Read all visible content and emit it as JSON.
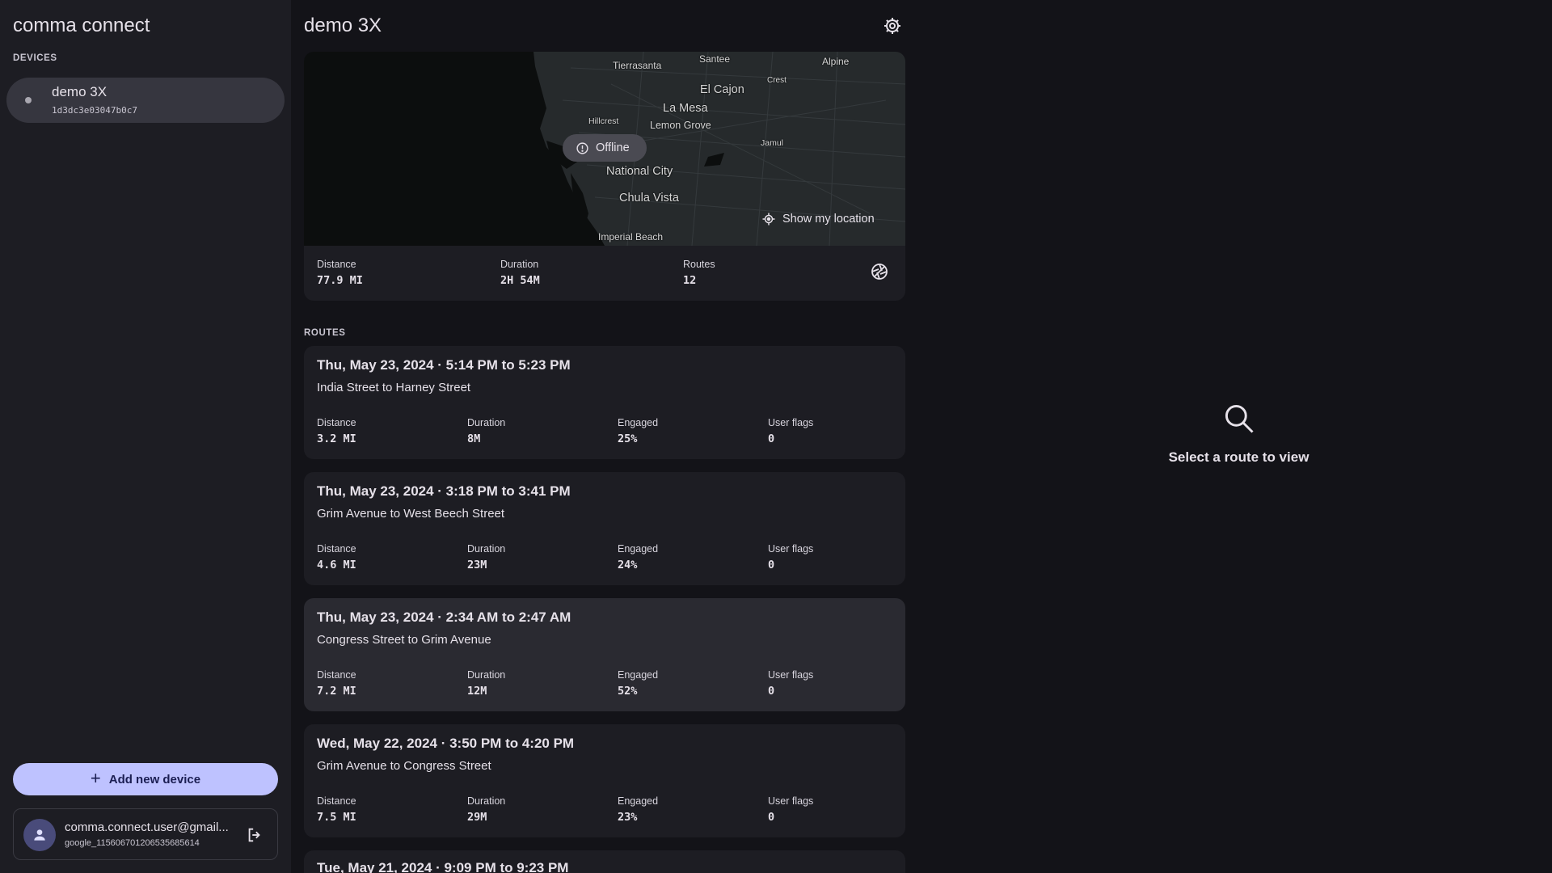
{
  "sidebar": {
    "app_title": "comma connect",
    "devices_label": "DEVICES",
    "device": {
      "name": "demo 3X",
      "dongle_id": "1d3dc3e03047b0c7"
    },
    "add_device_label": "Add new device",
    "user": {
      "email": "comma.connect.user@gmail...",
      "id": "google_115606701206535685614"
    }
  },
  "main": {
    "title": "demo 3X",
    "map": {
      "offline_label": "Offline",
      "show_location_label": "Show my location",
      "labels": [
        "Tierrasanta",
        "Santee",
        "Alpine",
        "Crest",
        "El Cajon",
        "La Mesa",
        "Hillcrest",
        "Lemon Grove",
        "Jamul",
        "National City",
        "Chula Vista",
        "Imperial Beach"
      ]
    },
    "stats": [
      {
        "label": "Distance",
        "value": "77.9 MI"
      },
      {
        "label": "Duration",
        "value": "2H 54M"
      },
      {
        "label": "Routes",
        "value": "12"
      }
    ],
    "routes_label": "ROUTES",
    "routes": [
      {
        "title": "Thu, May 23, 2024  ·  5:14 PM to 5:23 PM",
        "subtitle": "India Street to Harney Street",
        "stats": [
          {
            "label": "Distance",
            "value": "3.2 MI"
          },
          {
            "label": "Duration",
            "value": "8M"
          },
          {
            "label": "Engaged",
            "value": "25%"
          },
          {
            "label": "User flags",
            "value": "0"
          }
        ]
      },
      {
        "title": "Thu, May 23, 2024  ·  3:18 PM to 3:41 PM",
        "subtitle": "Grim Avenue to West Beech Street",
        "stats": [
          {
            "label": "Distance",
            "value": "4.6 MI"
          },
          {
            "label": "Duration",
            "value": "23M"
          },
          {
            "label": "Engaged",
            "value": "24%"
          },
          {
            "label": "User flags",
            "value": "0"
          }
        ]
      },
      {
        "title": "Thu, May 23, 2024  ·  2:34 AM to 2:47 AM",
        "subtitle": "Congress Street to Grim Avenue",
        "stats": [
          {
            "label": "Distance",
            "value": "7.2 MI"
          },
          {
            "label": "Duration",
            "value": "12M"
          },
          {
            "label": "Engaged",
            "value": "52%"
          },
          {
            "label": "User flags",
            "value": "0"
          }
        ]
      },
      {
        "title": "Wed, May 22, 2024  ·  3:50 PM to 4:20 PM",
        "subtitle": "Grim Avenue to Congress Street",
        "stats": [
          {
            "label": "Distance",
            "value": "7.5 MI"
          },
          {
            "label": "Duration",
            "value": "29M"
          },
          {
            "label": "Engaged",
            "value": "23%"
          },
          {
            "label": "User flags",
            "value": "0"
          }
        ]
      },
      {
        "title": "Tue, May 21, 2024  ·  9:09 PM to 9:23 PM"
      }
    ]
  },
  "detail": {
    "empty_text": "Select a route to view"
  },
  "icons": [
    "settings-gear-icon",
    "offline-alert-icon",
    "my-location-icon",
    "timelapse-icon",
    "search-icon",
    "plus-icon",
    "person-icon",
    "logout-icon"
  ],
  "colors": {
    "background": "#131318",
    "sidebar": "#1d1d23",
    "accent": "#bec2ff",
    "selected_card": "#2a2a31"
  }
}
